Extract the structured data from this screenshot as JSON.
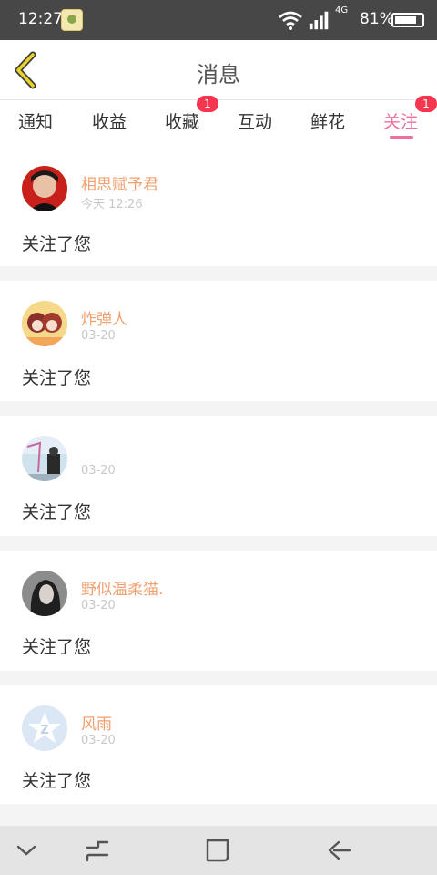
{
  "status_bar": {
    "time": "12:27",
    "network": "4G",
    "battery": "81%"
  },
  "header": {
    "title": "消息",
    "back_icon": "chevron-left-icon",
    "accent_color": "#e8d22a"
  },
  "tabs": [
    {
      "label": "通知",
      "active": false
    },
    {
      "label": "收益",
      "active": false
    },
    {
      "label": "收藏",
      "active": false,
      "badge": "1"
    },
    {
      "label": "互动",
      "active": false
    },
    {
      "label": "鲜花",
      "active": false
    },
    {
      "label": "关注",
      "active": true,
      "badge": "1"
    }
  ],
  "colors": {
    "active_tab": "#ee6ea0",
    "badge": "#f5364f",
    "username": "#f0a070",
    "timestamp": "#c8c8c8"
  },
  "items": [
    {
      "name": "相思赋予君",
      "time": "今天 12:26",
      "action": "关注了您"
    },
    {
      "name": "炸弹人",
      "time": "03-20",
      "action": "关注了您"
    },
    {
      "name": "",
      "time": "03-20",
      "action": "关注了您"
    },
    {
      "name": "野似温柔猫.",
      "time": "03-20",
      "action": "关注了您"
    },
    {
      "name": "风雨",
      "time": "03-20",
      "action": "关注了您"
    }
  ],
  "nav_bar": {
    "buttons": [
      "chevron-down-icon",
      "recent-apps-icon",
      "home-icon",
      "back-arrow-icon"
    ]
  }
}
